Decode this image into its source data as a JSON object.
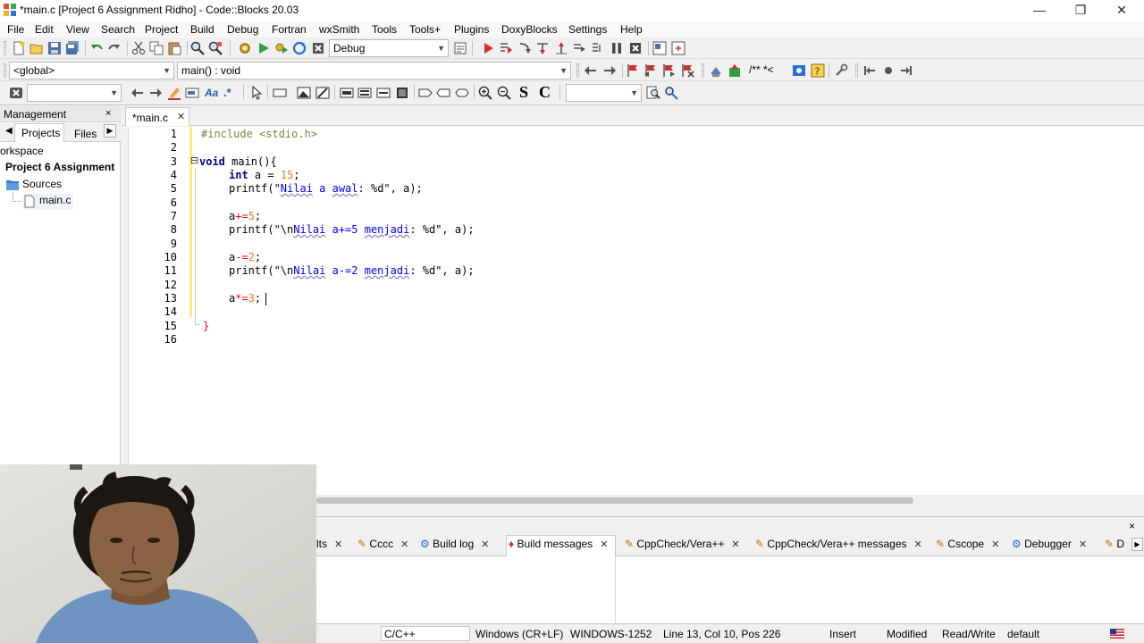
{
  "window": {
    "title": "*main.c [Project 6 Assignment Ridho] - Code::Blocks 20.03",
    "minimize": "—",
    "restore": "❐",
    "close": "✕"
  },
  "menu": [
    "File",
    "Edit",
    "View",
    "Search",
    "Project",
    "Build",
    "Debug",
    "Fortran",
    "wxSmith",
    "Tools",
    "Tools+",
    "Plugins",
    "DoxyBlocks",
    "Settings",
    "Help"
  ],
  "toolbar": {
    "build_target": "Debug",
    "scope": "<global>",
    "function": "main() : void",
    "search_value": "",
    "font_S": "S",
    "font_C": "C",
    "comment_block": "/** *<"
  },
  "management": {
    "title": "Management",
    "close": "×",
    "tabs": [
      "Projects",
      "Files"
    ],
    "workspace": "orkspace",
    "project": "Project 6 Assignment",
    "folder": "Sources",
    "file": "main.c"
  },
  "editor": {
    "tab_label": "*main.c",
    "tab_close": "✕",
    "line_numbers": [
      "1",
      "2",
      "3",
      "4",
      "5",
      "6",
      "7",
      "8",
      "9",
      "10",
      "11",
      "12",
      "13",
      "14",
      "15",
      "16"
    ],
    "fold_marker": "⊟"
  },
  "code": {
    "l1": "#include <stdio.h>",
    "l3_kw": "void",
    "l3_rest": " main(){",
    "l4_kw": "int",
    "l4_rest": " a = ",
    "l4_num": "15",
    "l4_end": ";",
    "l5_pre": "printf(\"",
    "l5_u": "Nilai",
    "l5_mid": " a ",
    "l5_u2": "awal",
    "l5_end": ": %d\", a);",
    "l7_a": "a",
    "l7_op": "+=",
    "l7_num": "5",
    "l7_end": ";",
    "l8_pre": "printf(\"\\n",
    "l8_u": "Nilai",
    "l8_mid": " a+=5 ",
    "l8_u2": "menjadi",
    "l8_end": ": %d\", a);",
    "l10_a": "a",
    "l10_op": "-=",
    "l10_num": "2",
    "l10_end": ";",
    "l11_pre": "printf(\"\\n",
    "l11_u": "Nilai",
    "l11_mid": " a-=2 ",
    "l11_u2": "menjadi",
    "l11_end": ": %d\", a);",
    "l13_a": "a",
    "l13_op": "*=",
    "l13_num": "3",
    "l13_end": ";",
    "l15": "}"
  },
  "logs": {
    "close": "×",
    "tabs": [
      {
        "label": "lts",
        "close": "✕"
      },
      {
        "label": "Cccc",
        "close": "✕"
      },
      {
        "label": "Build log",
        "close": "✕"
      },
      {
        "label": "Build messages",
        "close": "✕"
      },
      {
        "label": "CppCheck/Vera++",
        "close": "✕"
      },
      {
        "label": "CppCheck/Vera++ messages",
        "close": "✕"
      },
      {
        "label": "Cscope",
        "close": "✕"
      },
      {
        "label": "Debugger",
        "close": "✕"
      },
      {
        "label": "D",
        "close": ""
      }
    ]
  },
  "status": {
    "language": "C/C++",
    "eol": "Windows (CR+LF)",
    "encoding": "WINDOWS-1252",
    "position": "Line 13, Col 10, Pos 226",
    "mode": "Insert",
    "modified": "Modified",
    "access": "Read/Write",
    "profile": "default"
  }
}
